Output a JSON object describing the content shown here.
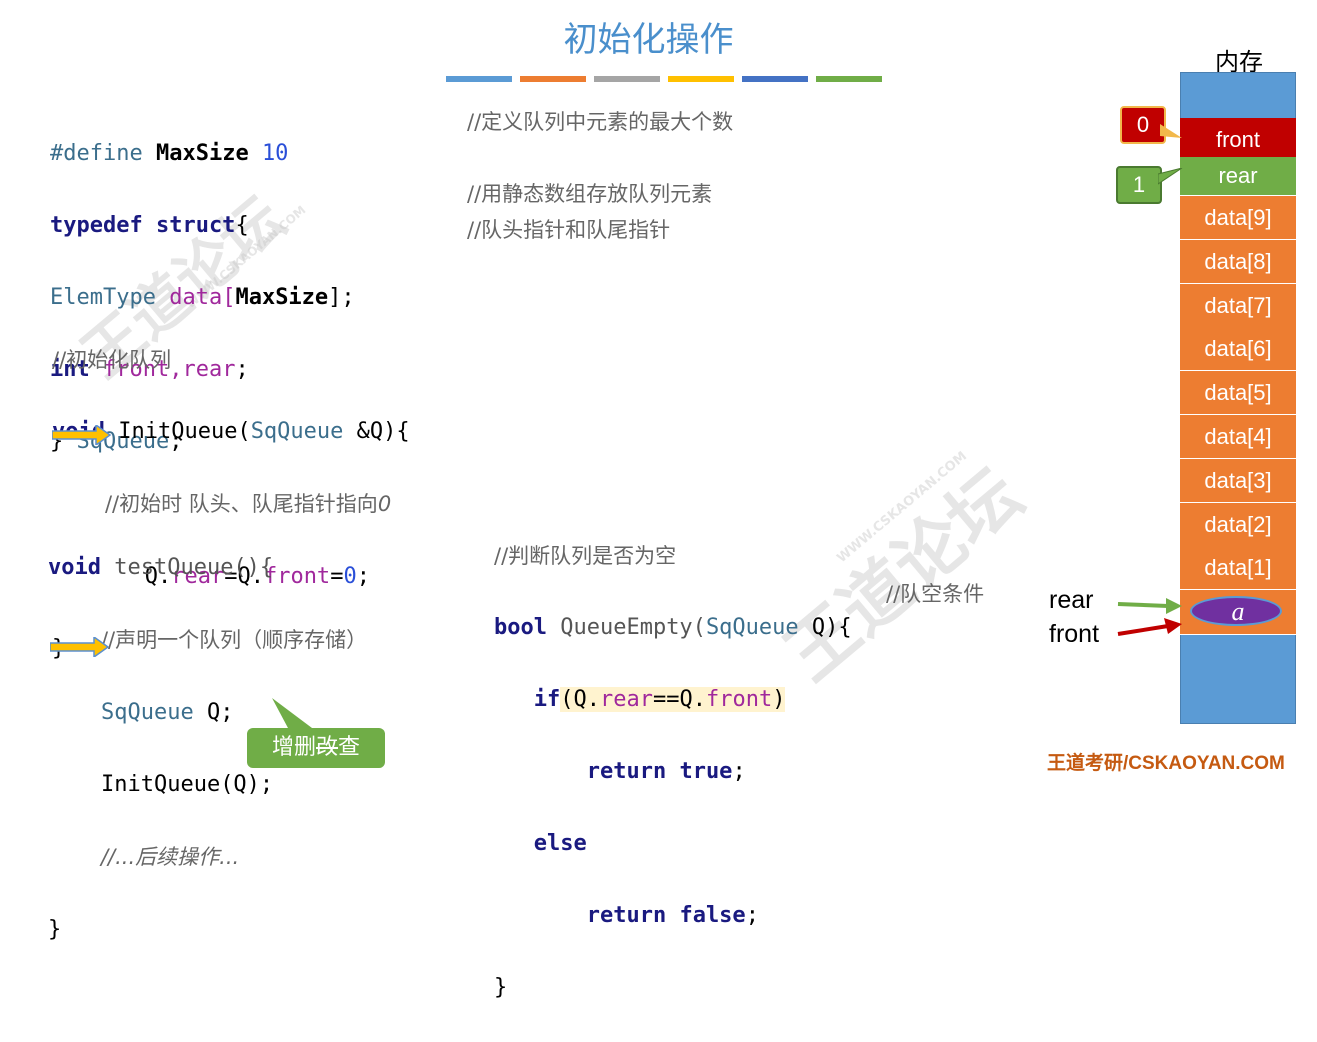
{
  "slide": {
    "title": "初始化操作",
    "title_bar_colors": [
      "#5b9bd5",
      "#ed7d31",
      "#a5a5a5",
      "#ffc000",
      "#4472c4",
      "#70ad47"
    ]
  },
  "code_struct": {
    "line1_kw": "#define",
    "line1_name": "MaxSize",
    "line1_val": "10",
    "line1_comment": "//定义队列中元素的最大个数",
    "line2_kw": "typedef struct",
    "line2_rest": "{",
    "line3_type": "ElemType",
    "line3_field": "data[",
    "line3_size": "MaxSize",
    "line3_end": "];",
    "line3_comment": "//用静态数组存放队列元素",
    "line4_kw": "int",
    "line4_fields": "front,rear",
    "line4_end": ";",
    "line4_comment": "//队头指针和队尾指针",
    "line5_close": "} ",
    "line5_type": "SqQueue",
    "line5_end": ";"
  },
  "code_init": {
    "comment": "//初始化队列",
    "sig_kw": "void",
    "sig_name": " InitQueue(",
    "sig_type": "SqQueue",
    "sig_rest": " &Q){",
    "inner_comment": "//初始时 队头、队尾指针指向",
    "inner_comment_zero": "0",
    "stmt_a": "Q.",
    "stmt_rear": "rear",
    "stmt_b": "=Q.",
    "stmt_front": "front",
    "stmt_c": "=",
    "stmt_zero": "0",
    "stmt_d": ";",
    "close": "}"
  },
  "code_test": {
    "sig_kw": "void",
    "sig_name": " testQueue(){",
    "comment": "//声明一个队列（顺序存储）",
    "decl_type": "SqQueue",
    "decl_var": " Q;",
    "call": "InitQueue(Q);",
    "dots": "//...后续操作...",
    "close": "}"
  },
  "code_empty": {
    "comment": "//判断队列是否为空",
    "sig_kw": "bool",
    "sig_name": " QueueEmpty(",
    "sig_type": "SqQueue",
    "sig_rest": " Q){",
    "if_kw": "if",
    "if_a": "(Q.",
    "if_rear": "rear",
    "if_b": "==Q.",
    "if_front": "front",
    "if_c": ")",
    "if_comment": "//队空条件",
    "ret_kw": "return",
    "ret_true": " true",
    "ret_end": ";",
    "else_kw": "else",
    "ret2_kw": "return",
    "ret_false": " false",
    "ret2_end": ";",
    "close": "}"
  },
  "callout": {
    "text_a": "增删",
    "text_strike": "改",
    "text_b": "查"
  },
  "memory": {
    "label": "内存",
    "front_label": "front",
    "rear_label": "rear",
    "front_index": "0",
    "rear_index": "1",
    "cells": [
      "data[9]",
      "data[8]",
      "data[7]",
      "data[6]",
      "data[5]",
      "data[4]",
      "data[3]",
      "data[2]",
      "data[1]"
    ],
    "bottom_element": "a",
    "ptr_rear": "rear",
    "ptr_front": "front"
  },
  "footer": "王道考研/CSKAOYAN.COM",
  "watermark": {
    "text": "王道论坛",
    "site": "WWW.CSKAOYAN.COM"
  }
}
